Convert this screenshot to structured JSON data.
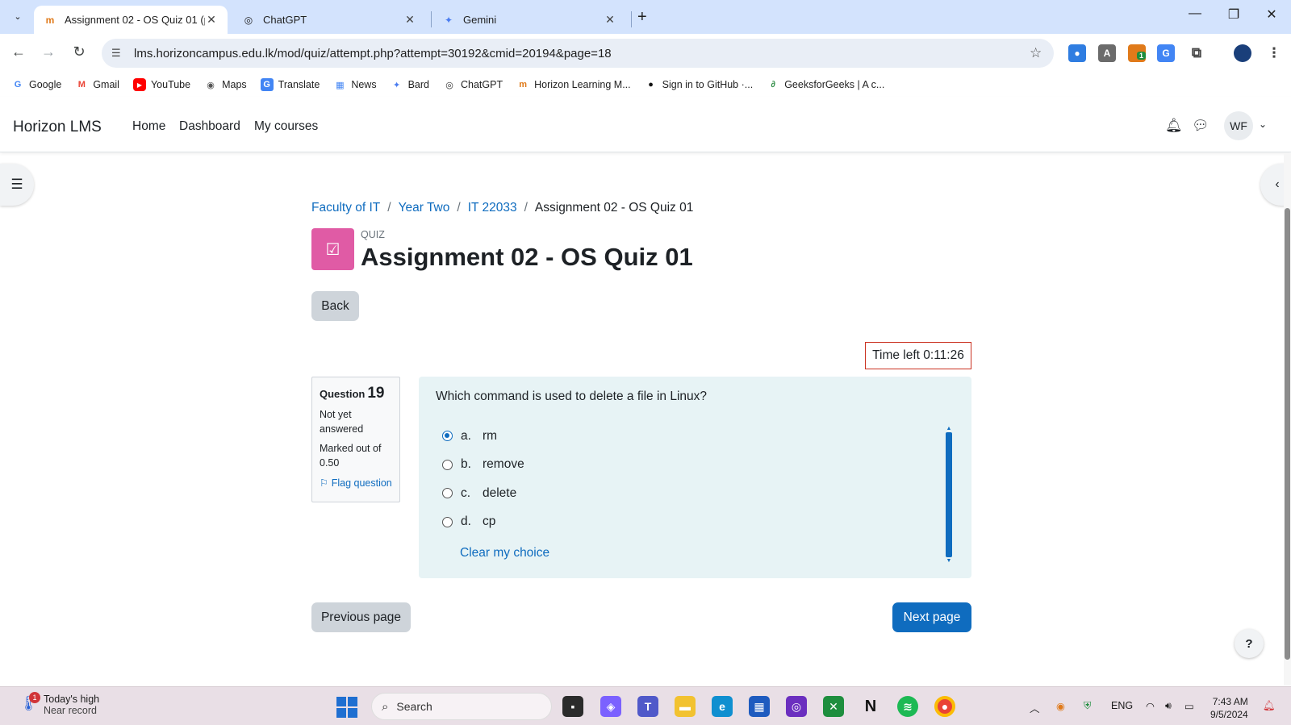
{
  "browser": {
    "tabs": [
      {
        "title": "Assignment 02 - OS Quiz 01 (p",
        "close": "✕"
      },
      {
        "title": "ChatGPT",
        "close": "✕"
      },
      {
        "title": "Gemini",
        "close": "✕"
      }
    ],
    "new_tab": "+",
    "url": "lms.horizoncampus.edu.lk/mod/quiz/attempt.php?attempt=30192&cmid=20194&page=18",
    "extension_badge": "1",
    "profile_initial": ""
  },
  "bookmarks": [
    {
      "label": "Google",
      "icon": "G",
      "color": "#4285f4"
    },
    {
      "label": "Gmail",
      "icon": "M",
      "color": "#ea4335"
    },
    {
      "label": "YouTube",
      "icon": "▶",
      "color": "#ff0000"
    },
    {
      "label": "Maps",
      "icon": "◉",
      "color": "#555555"
    },
    {
      "label": "Translate",
      "icon": "G",
      "color": "#4285f4"
    },
    {
      "label": "News",
      "icon": "▦",
      "color": "#4285f4"
    },
    {
      "label": "Bard",
      "icon": "✦",
      "color": "#4a7cf0"
    },
    {
      "label": "ChatGPT",
      "icon": "◎",
      "color": "#333333"
    },
    {
      "label": "Horizon Learning M...",
      "icon": "m",
      "color": "#e07a1a"
    },
    {
      "label": "Sign in to GitHub ·...",
      "icon": "●",
      "color": "#111111"
    },
    {
      "label": "GeeksforGeeks | A c...",
      "icon": "∂",
      "color": "#2f8d46"
    }
  ],
  "site": {
    "brand": "Horizon LMS",
    "nav": [
      "Home",
      "Dashboard",
      "My courses"
    ],
    "user_initials": "WF"
  },
  "breadcrumb": {
    "items": [
      "Faculty of IT",
      "Year Two",
      "IT 22033"
    ],
    "current": "Assignment 02 - OS Quiz 01",
    "separator": "/"
  },
  "quiz": {
    "pretitle": "QUIZ",
    "title": "Assignment 02 - OS Quiz 01",
    "back_label": "Back",
    "timer": "Time left 0:11:26"
  },
  "question": {
    "label": "Question",
    "number": "19",
    "state": "Not yet answered",
    "mark": "Marked out of 0.50",
    "flag": "Flag question",
    "text": "Which command is used to delete a file in Linux?",
    "options": [
      {
        "letter": "a.",
        "text": "rm",
        "selected": true
      },
      {
        "letter": "b.",
        "text": "remove",
        "selected": false
      },
      {
        "letter": "c.",
        "text": "delete",
        "selected": false
      },
      {
        "letter": "d.",
        "text": "cp",
        "selected": false
      }
    ],
    "clear": "Clear my choice"
  },
  "nav_buttons": {
    "previous": "Previous page",
    "next": "Next page",
    "help": "?"
  },
  "taskbar": {
    "weather_title": "Today's high",
    "weather_sub": "Near record",
    "weather_badge": "1",
    "search": "Search",
    "lang": "ENG",
    "time": "7:43 AM",
    "date": "9/5/2024"
  },
  "colors": {
    "accent": "#0f6cbf",
    "quiz_icon": "#e05ba5",
    "timer_border": "#ca3120",
    "question_bg": "#e7f3f5"
  }
}
